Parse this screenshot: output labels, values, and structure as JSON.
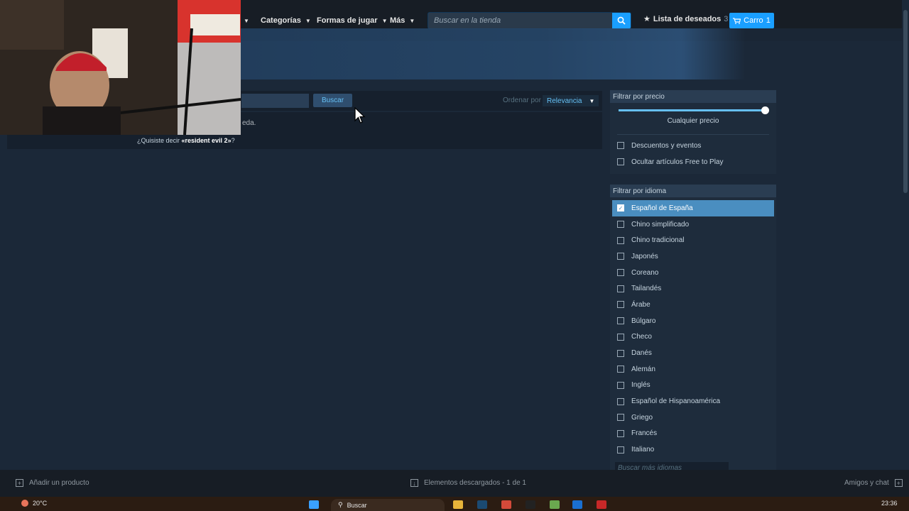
{
  "nav": {
    "menu": [
      {
        "label": "Categorías"
      },
      {
        "label": "Formas de jugar"
      },
      {
        "label": "Más"
      }
    ],
    "search_placeholder": "Buscar en la tienda",
    "wishlist_label": "Lista de deseados",
    "wishlist_count": "3",
    "cart_label": "Carro",
    "cart_count": "1"
  },
  "results": {
    "search_button": "Buscar",
    "sort_label": "Ordenar por",
    "sort_value": "Relevancia",
    "no_results_tail": "eda.",
    "did_you_mean_prefix": "¿Quisiste decir ",
    "did_you_mean_term": "«resident evil 2»",
    "did_you_mean_suffix": "?"
  },
  "price_filter": {
    "title": "Filtrar por precio",
    "slider_fraction": 1.0,
    "value_label": "Cualquier precio",
    "options": [
      {
        "label": "Descuentos y eventos",
        "checked": false
      },
      {
        "label": "Ocultar artículos Free to Play",
        "checked": false
      }
    ]
  },
  "language_filter": {
    "title": "Filtrar por idioma",
    "languages": [
      {
        "label": "Español de España",
        "checked": true
      },
      {
        "label": "Chino simplificado",
        "checked": false
      },
      {
        "label": "Chino tradicional",
        "checked": false
      },
      {
        "label": "Japonés",
        "checked": false
      },
      {
        "label": "Coreano",
        "checked": false
      },
      {
        "label": "Tailandés",
        "checked": false
      },
      {
        "label": "Árabe",
        "checked": false
      },
      {
        "label": "Búlgaro",
        "checked": false
      },
      {
        "label": "Checo",
        "checked": false
      },
      {
        "label": "Danés",
        "checked": false
      },
      {
        "label": "Alemán",
        "checked": false
      },
      {
        "label": "Inglés",
        "checked": false
      },
      {
        "label": "Español de Hispanoamérica",
        "checked": false
      },
      {
        "label": "Griego",
        "checked": false
      },
      {
        "label": "Francés",
        "checked": false
      },
      {
        "label": "Italiano",
        "checked": false
      }
    ],
    "more_placeholder": "Buscar más idiomas"
  },
  "client_bar": {
    "add_product": "Añadir un producto",
    "downloads": "Elementos descargados - 1 de 1",
    "friends": "Amigos y chat"
  },
  "taskbar": {
    "weather": "20°C",
    "search": "Buscar",
    "time": "23:36"
  },
  "colors": {
    "accent": "#1a9fff",
    "link": "#66c0f4",
    "background": "#1b2838"
  }
}
